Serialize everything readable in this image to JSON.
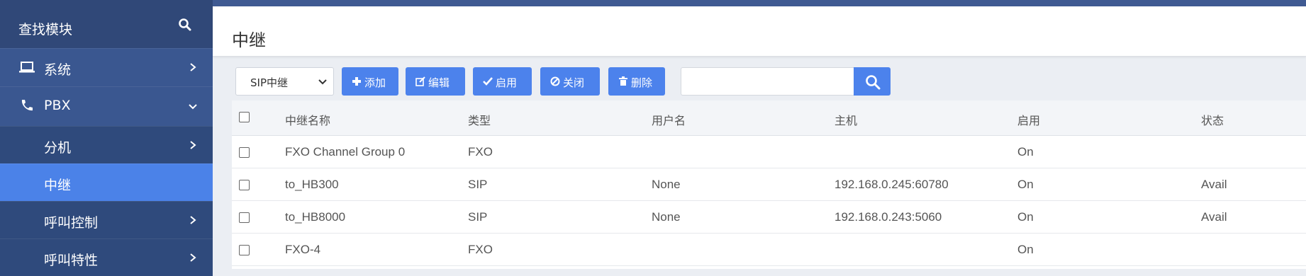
{
  "sidebar": {
    "search_label": "查找模块",
    "items": [
      {
        "label": "系统",
        "icon": "laptop-icon"
      },
      {
        "label": "PBX",
        "icon": "phone-icon"
      },
      {
        "label": "分机"
      },
      {
        "label": "中继"
      },
      {
        "label": "呼叫控制"
      },
      {
        "label": "呼叫特性"
      }
    ]
  },
  "header": {
    "title": "中继"
  },
  "toolbar": {
    "trunk_type_selected": "SIP中继",
    "add_label": "添加",
    "edit_label": "编辑",
    "enable_label": "启用",
    "disable_label": "关闭",
    "delete_label": "删除",
    "search_placeholder": ""
  },
  "table": {
    "columns": [
      "中继名称",
      "类型",
      "用户名",
      "主机",
      "启用",
      "状态"
    ],
    "rows": [
      {
        "name": "FXO Channel Group 0",
        "type": "FXO",
        "username": "",
        "host": "",
        "enabled": "On",
        "status": ""
      },
      {
        "name": "to_HB300",
        "type": "SIP",
        "username": "None",
        "host": "192.168.0.245:60780",
        "enabled": "On",
        "status": "Avail"
      },
      {
        "name": "to_HB8000",
        "type": "SIP",
        "username": "None",
        "host": "192.168.0.243:5060",
        "enabled": "On",
        "status": "Avail"
      },
      {
        "name": "FXO-4",
        "type": "FXO",
        "username": "",
        "host": "",
        "enabled": "On",
        "status": ""
      }
    ]
  },
  "colors": {
    "sidebar_bg": "#2f4a7c",
    "sidebar_active": "#4b82e8",
    "button_blue": "#4c82ec",
    "top_strip": "#3f5a92"
  }
}
